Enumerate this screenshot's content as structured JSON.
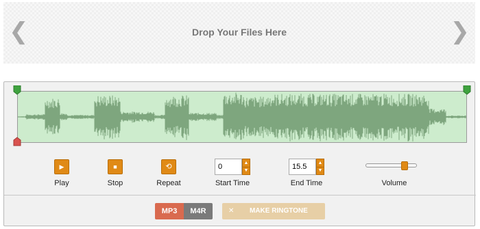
{
  "dropzone": {
    "text": "Drop Your Files Here",
    "prev_icon": "chevron-left-icon",
    "next_icon": "chevron-right-icon",
    "prev_glyph": "❮",
    "next_glyph": "❯"
  },
  "waveform": {
    "background_color": "#cdeccd",
    "wave_color": "#7ea67e",
    "start_marker_color": "#3fa23f",
    "playhead_marker_color": "#d9534f"
  },
  "controls": {
    "play": {
      "label": "Play",
      "glyph": "▶",
      "icon": "play-icon"
    },
    "stop": {
      "label": "Stop",
      "glyph": "■",
      "icon": "stop-icon"
    },
    "repeat": {
      "label": "Repeat",
      "glyph": "⟲",
      "icon": "repeat-icon"
    },
    "start_time": {
      "label": "Start Time",
      "value": "0"
    },
    "end_time": {
      "label": "End Time",
      "value": "15.5"
    },
    "volume": {
      "label": "Volume",
      "level_fraction": 0.8
    }
  },
  "format": {
    "mp3": "MP3",
    "m4r": "M4R",
    "selected": "MP3"
  },
  "make_button": {
    "label": "MAKE RINGTONE",
    "icon_glyph": "✕"
  },
  "colors": {
    "accent": "#e08a16",
    "mp3_active": "#d96a4f",
    "m4r_inactive": "#7a7a7a",
    "make_disabled": "#e7cfa6"
  }
}
